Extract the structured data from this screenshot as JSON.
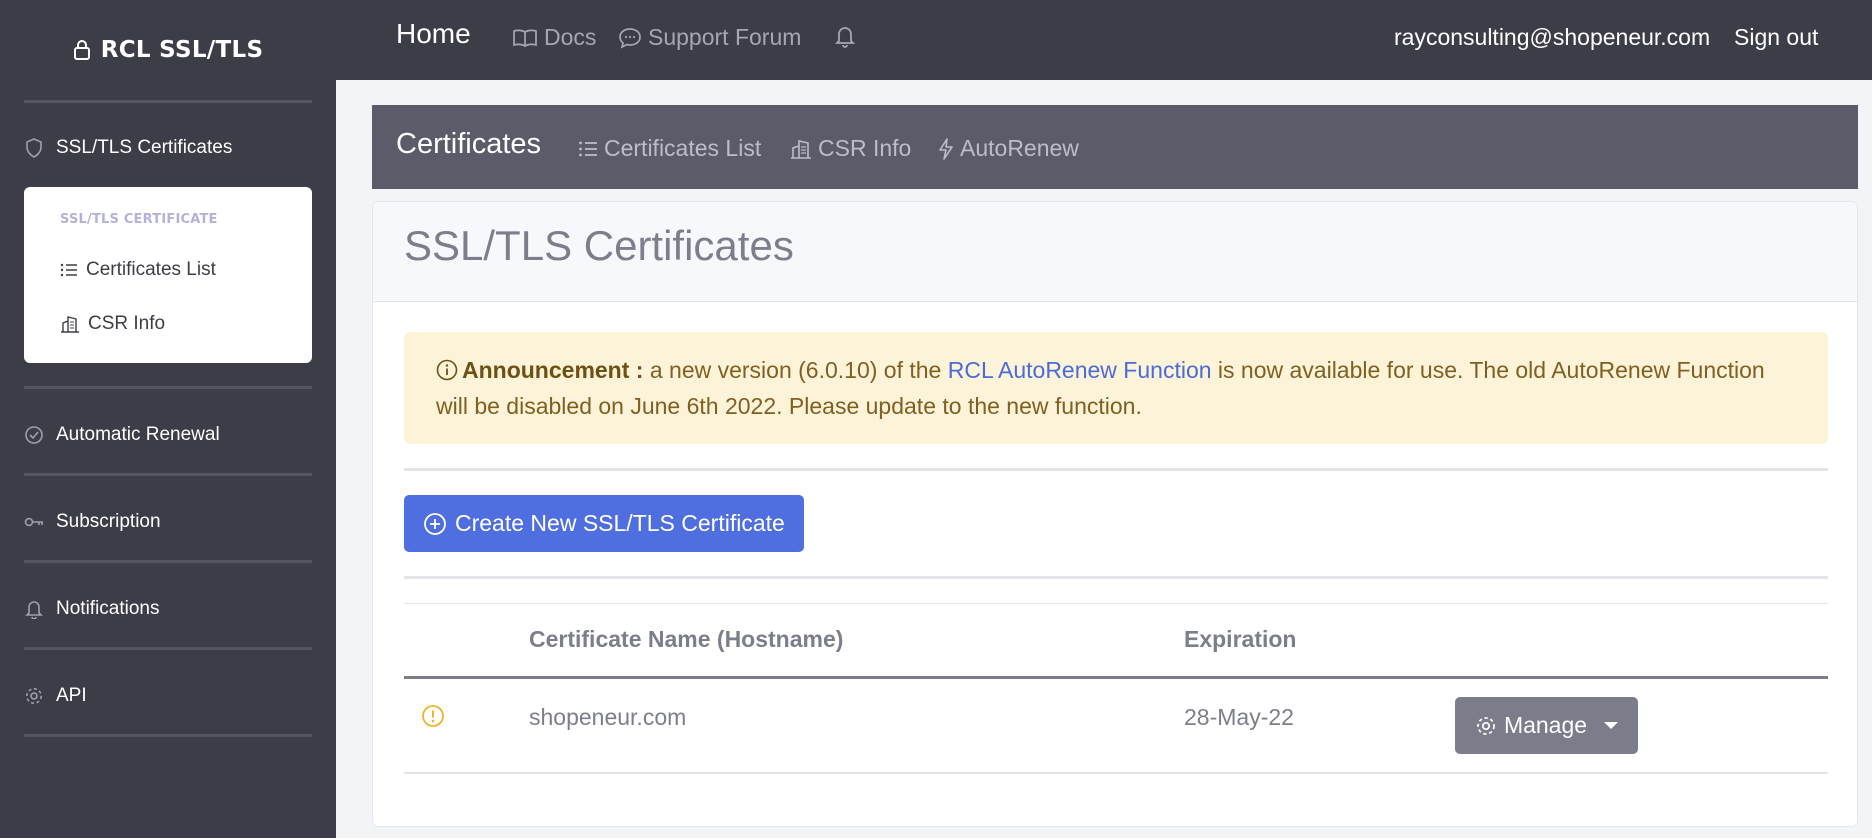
{
  "brand": {
    "name": "RCL SSL/TLS",
    "icon": "lock-icon"
  },
  "sidebar": {
    "items": [
      {
        "label": "SSL/TLS Certificates",
        "icon": "shield-icon"
      },
      {
        "label": "Automatic Renewal",
        "icon": "check-circle-icon"
      },
      {
        "label": "Subscription",
        "icon": "key-icon"
      },
      {
        "label": "Notifications",
        "icon": "bell-icon"
      },
      {
        "label": "API",
        "icon": "gear-icon"
      }
    ],
    "submenu": {
      "header": "SSL/TLS CERTIFICATE",
      "items": [
        {
          "label": "Certificates List",
          "icon": "list-icon"
        },
        {
          "label": "CSR Info",
          "icon": "building-icon"
        }
      ]
    }
  },
  "topbar": {
    "home": "Home",
    "docs": "Docs",
    "forum": "Support Forum",
    "email": "rayconsulting@shopeneur.com",
    "signout": "Sign out"
  },
  "subnav": {
    "title": "Certificates",
    "links": [
      "Certificates List",
      "CSR Info",
      "AutoRenew"
    ]
  },
  "main": {
    "title": "SSL/TLS Certificates",
    "announcement": {
      "label": "Announcement :",
      "text_before": " a new version (6.0.10) of the ",
      "link": "RCL AutoRenew Function",
      "text_after": " is now available for use. The old AutoRenew Function will be disabled on June 6th 2022. Please update to the new function."
    },
    "create_button": "Create New SSL/TLS Certificate",
    "table": {
      "columns": [
        "Certificate Name (Hostname)",
        "Expiration"
      ],
      "rows": [
        {
          "hostname": "shopeneur.com",
          "expiration": "28-May-22",
          "action": "Manage",
          "status_icon": "warning-icon"
        }
      ]
    }
  },
  "colors": {
    "sidebar_bg": "#3c3d47",
    "primary": "#4f6fe0",
    "warning": "#f0b429",
    "alert_bg": "#fdf3d8"
  }
}
